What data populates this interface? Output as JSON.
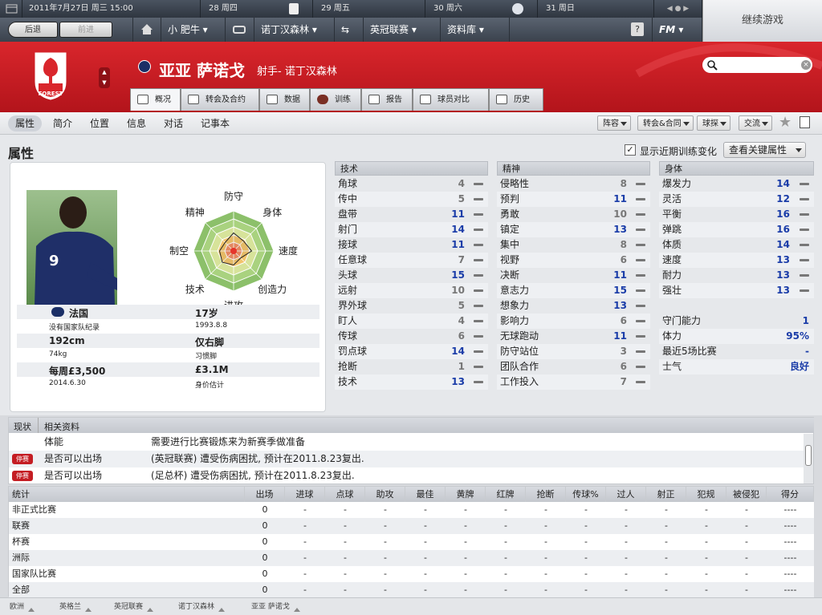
{
  "topbar": {
    "date": "2011年7月27日 周三 15:00",
    "days": [
      "28 周四",
      "29 周五",
      "30 周六",
      "31 周日"
    ],
    "continue_label": "继续游戏"
  },
  "navbar": {
    "back": "后退",
    "forward": "前进",
    "manager": "小 肥牛",
    "club": "诺丁汉森林",
    "league": "英冠联赛",
    "database": "资料库",
    "help": "?",
    "fm": "FM"
  },
  "player": {
    "name": "亚亚 萨诺戈",
    "subtitle": "射手- 诺丁汉森林",
    "nation": "法国",
    "intl": "没有国家队纪录",
    "height": "192cm",
    "weight": "74kg",
    "wage": "每周£3,500",
    "contract": "2014.6.30",
    "age": "17岁",
    "dob": "1993.8.8",
    "foot": "仅右脚",
    "foot_label": "习惯脚",
    "value": "£3.1M",
    "value_label": "身价估计",
    "shirt": "9",
    "crest_text": "FOREST"
  },
  "tabs": [
    "概况",
    "转会及合约",
    "数据",
    "训练",
    "报告",
    "球员对比",
    "历史"
  ],
  "subnav": [
    "属性",
    "简介",
    "位置",
    "信息",
    "对话",
    "记事本"
  ],
  "actions": [
    "阵容",
    "转会&合同",
    "球探",
    "交流"
  ],
  "section_title": "属性",
  "show_training": "显示近期训练变化",
  "key_attr": "查看关键属性",
  "radar": {
    "labels": [
      "防守",
      "身体",
      "速度",
      "创造力",
      "进攻",
      "技术",
      "制空",
      "精神"
    ],
    "values": [
      0.45,
      0.35,
      0.45,
      0.25,
      0.35,
      0.4,
      0.35,
      0.3
    ]
  },
  "technical": {
    "title": "技术",
    "rows": [
      [
        "角球",
        "4"
      ],
      [
        "传中",
        "5"
      ],
      [
        "盘带",
        "11"
      ],
      [
        "射门",
        "14"
      ],
      [
        "接球",
        "11"
      ],
      [
        "任意球",
        "7"
      ],
      [
        "头球",
        "15"
      ],
      [
        "远射",
        "10"
      ],
      [
        "界外球",
        "5"
      ],
      [
        "盯人",
        "4"
      ],
      [
        "传球",
        "6"
      ],
      [
        "罚点球",
        "14"
      ],
      [
        "抢断",
        "1"
      ],
      [
        "技术",
        "13"
      ]
    ]
  },
  "mental": {
    "title": "精神",
    "rows": [
      [
        "侵略性",
        "8"
      ],
      [
        "预判",
        "11"
      ],
      [
        "勇敢",
        "10"
      ],
      [
        "镇定",
        "13"
      ],
      [
        "集中",
        "8"
      ],
      [
        "视野",
        "6"
      ],
      [
        "决断",
        "11"
      ],
      [
        "意志力",
        "15"
      ],
      [
        "想象力",
        "13"
      ],
      [
        "影响力",
        "6"
      ],
      [
        "无球跑动",
        "11"
      ],
      [
        "防守站位",
        "3"
      ],
      [
        "团队合作",
        "6"
      ],
      [
        "工作投入",
        "7"
      ]
    ]
  },
  "physical": {
    "title": "身体",
    "rows": [
      [
        "爆发力",
        "14"
      ],
      [
        "灵活",
        "12"
      ],
      [
        "平衡",
        "16"
      ],
      [
        "弹跳",
        "16"
      ],
      [
        "体质",
        "14"
      ],
      [
        "速度",
        "13"
      ],
      [
        "耐力",
        "13"
      ],
      [
        "强壮",
        "13"
      ]
    ]
  },
  "extra": [
    [
      "守门能力",
      "1"
    ],
    [
      "体力",
      "95%"
    ],
    [
      "最近5场比赛",
      "-"
    ],
    [
      "士气",
      "良好"
    ]
  ],
  "status": {
    "head": [
      "现状",
      "相关资料"
    ],
    "rows": [
      [
        "",
        "体能",
        "需要进行比赛锻炼来为新赛季做准备"
      ],
      [
        "停赛",
        "是否可以出场",
        "(英冠联赛) 遭受伤病困扰, 预计在2011.8.23复出."
      ],
      [
        "停赛",
        "是否可以出场",
        "(足总杯) 遭受伤病困扰, 预计在2011.8.23复出."
      ]
    ]
  },
  "stats": {
    "headers": [
      "统计",
      "出场",
      "进球",
      "点球",
      "助攻",
      "最佳",
      "黄牌",
      "红牌",
      "抢断",
      "传球%",
      "过人",
      "射正",
      "犯规",
      "被侵犯",
      "得分"
    ],
    "rows": [
      [
        "非正式比赛",
        "0",
        "-",
        "-",
        "-",
        "-",
        "-",
        "-",
        "-",
        "-",
        "-",
        "-",
        "-",
        "-",
        "----"
      ],
      [
        "联赛",
        "0",
        "-",
        "-",
        "-",
        "-",
        "-",
        "-",
        "-",
        "-",
        "-",
        "-",
        "-",
        "-",
        "----"
      ],
      [
        "杯赛",
        "0",
        "-",
        "-",
        "-",
        "-",
        "-",
        "-",
        "-",
        "-",
        "-",
        "-",
        "-",
        "-",
        "----"
      ],
      [
        "洲际",
        "0",
        "-",
        "-",
        "-",
        "-",
        "-",
        "-",
        "-",
        "-",
        "-",
        "-",
        "-",
        "-",
        "----"
      ],
      [
        "国家队比赛",
        "0",
        "-",
        "-",
        "-",
        "-",
        "-",
        "-",
        "-",
        "-",
        "-",
        "-",
        "-",
        "-",
        "----"
      ],
      [
        "全部",
        "0",
        "-",
        "-",
        "-",
        "-",
        "-",
        "-",
        "-",
        "-",
        "-",
        "-",
        "-",
        "-",
        "----"
      ]
    ]
  },
  "footer": [
    "欧洲",
    "英格兰",
    "英冠联赛",
    "诺丁汉森林",
    "亚亚 萨诺戈"
  ],
  "colors": {
    "red": "#c41d23",
    "blue": "#1a3ca8"
  }
}
